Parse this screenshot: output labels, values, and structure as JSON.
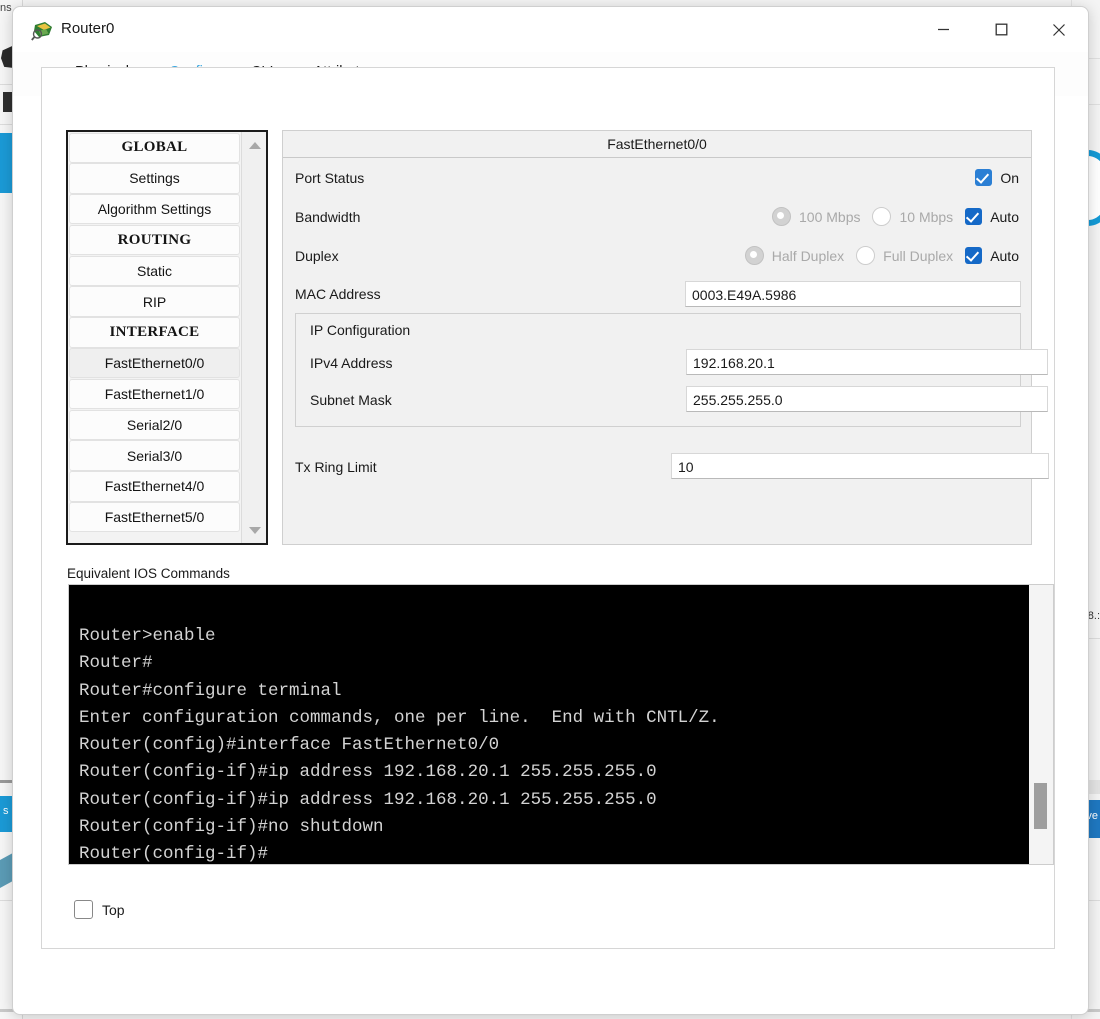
{
  "background": {
    "left_label": "ns",
    "right_label": "8.:",
    "right_blue_label": "ve",
    "left_blue_label": "s ."
  },
  "window": {
    "title": "Router0",
    "icon": "packet-tracer-icon",
    "controls": {
      "minimize": "minimize-icon",
      "maximize": "maximize-icon",
      "close": "close-icon"
    }
  },
  "tabs": [
    {
      "label": "Physical",
      "active": false
    },
    {
      "label": "Config",
      "active": true
    },
    {
      "label": "CLI",
      "active": false
    },
    {
      "label": "Attributes",
      "active": false
    }
  ],
  "sidebar": {
    "items": [
      {
        "label": "GLOBAL",
        "type": "header"
      },
      {
        "label": "Settings",
        "type": "item"
      },
      {
        "label": "Algorithm Settings",
        "type": "item"
      },
      {
        "label": "ROUTING",
        "type": "header"
      },
      {
        "label": "Static",
        "type": "item"
      },
      {
        "label": "RIP",
        "type": "item"
      },
      {
        "label": "INTERFACE",
        "type": "header"
      },
      {
        "label": "FastEthernet0/0",
        "type": "item",
        "selected": true
      },
      {
        "label": "FastEthernet1/0",
        "type": "item"
      },
      {
        "label": "Serial2/0",
        "type": "item"
      },
      {
        "label": "Serial3/0",
        "type": "item"
      },
      {
        "label": "FastEthernet4/0",
        "type": "item"
      },
      {
        "label": "FastEthernet5/0",
        "type": "item"
      }
    ],
    "scroll_up": "scroll-up-arrow",
    "scroll_down": "scroll-down-arrow"
  },
  "config": {
    "panel_title": "FastEthernet0/0",
    "port_status": {
      "label": "Port Status",
      "on_label": "On",
      "on_checked": true
    },
    "bandwidth": {
      "label": "Bandwidth",
      "option_100": "100 Mbps",
      "option_10": "10 Mbps",
      "option_100_selected": true,
      "option_10_selected": false,
      "auto_label": "Auto",
      "auto_checked": true
    },
    "duplex": {
      "label": "Duplex",
      "option_half": "Half Duplex",
      "option_full": "Full Duplex",
      "option_half_selected": true,
      "option_full_selected": false,
      "auto_label": "Auto",
      "auto_checked": true
    },
    "mac": {
      "label": "MAC Address",
      "value": "0003.E49A.5986"
    },
    "ip_configuration": {
      "title": "IP Configuration",
      "ipv4_label": "IPv4 Address",
      "ipv4_value": "192.168.20.1",
      "subnet_label": "Subnet Mask",
      "subnet_value": "255.255.255.0"
    },
    "tx_ring_limit": {
      "label": "Tx Ring Limit",
      "value": "10"
    }
  },
  "ios": {
    "label": "Equivalent IOS Commands",
    "lines": [
      "Router>enable",
      "Router#",
      "Router#configure terminal",
      "Enter configuration commands, one per line.  End with CNTL/Z.",
      "Router(config)#interface FastEthernet0/0",
      "Router(config-if)#ip address 192.168.20.1 255.255.255.0",
      "Router(config-if)#ip address 192.168.20.1 255.255.255.0",
      "Router(config-if)#no shutdown",
      "Router(config-if)#"
    ]
  },
  "footer": {
    "top_label": "Top",
    "top_checked": false
  },
  "colors": {
    "accent_blue": "#1596d8",
    "checkbox_blue": "#1569c7",
    "tab_active_text": "#3aa7e0",
    "console_bg": "#000000",
    "console_text": "#d3d3d3"
  }
}
